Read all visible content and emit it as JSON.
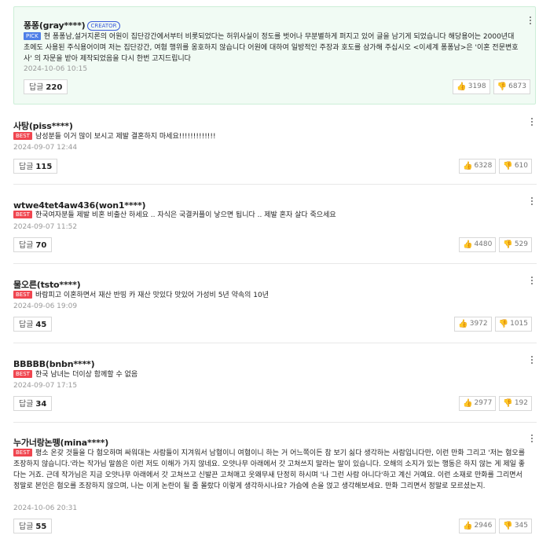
{
  "comments": [
    {
      "author": "퐁퐁(gray****)",
      "badge": "CREATOR",
      "tag": "PICK",
      "text": "현 퐁퐁남,설거지론의 어원이 집단강간에서부터 비롯되었다는 허위사실이 정도를 벗어나 무분별하게 퍼지고 있어 글을 남기게 되었습니다 해당용어는 2000년대 초에도 사용된 주식용어이며 저는 집단강간, 여혐 행위를 옹호하지 않습니다 어원에 대하여 일방적인 주장과 호도를 삼가해 주십시오 <이세계 퐁퐁남>은 '이혼 전문변호사' 의 자문을 받아 제작되었음을 다시 한번 고지드립니다",
      "date": "2024-10-06 10:15",
      "reply_label": "답글",
      "reply_count": "220",
      "likes": "3198",
      "dislikes": "6873"
    },
    {
      "author": "사탕(piss****)",
      "tag": "BEST",
      "text": "남성분들 이거 많이 보시고 제발 결혼하지 마세요!!!!!!!!!!!!!",
      "date": "2024-09-07 12:44",
      "reply_label": "답글",
      "reply_count": "115",
      "likes": "6328",
      "dislikes": "610"
    },
    {
      "author": "wtwe4tet4aw436(won1****)",
      "tag": "BEST",
      "text": "한국여자분들 제발 비혼 비출산 하세요 .. 자식은 국결커플이 낳으면 됩니다 .. 제발 혼자 살다 죽으세요",
      "date": "2024-09-07 11:52",
      "reply_label": "답글",
      "reply_count": "70",
      "likes": "4480",
      "dislikes": "529"
    },
    {
      "author": "물오른(tsto****)",
      "tag": "BEST",
      "text": "바람피고 이혼하면서 재산 반띵 카 재산 맛있다 맛있어 가성비 5년 약속의 10년",
      "date": "2024-09-06 19:09",
      "reply_label": "답글",
      "reply_count": "45",
      "likes": "3972",
      "dislikes": "1015"
    },
    {
      "author": "BBBBB(bnbn****)",
      "tag": "BEST",
      "text": "한국 남녀는 더이상 함께할 수 없음",
      "date": "2024-09-07 17:15",
      "reply_label": "답글",
      "reply_count": "34",
      "likes": "2977",
      "dislikes": "192"
    },
    {
      "author": "누가너랑논뗑(mina****)",
      "tag": "BEST",
      "text": "평소 온갖 것들을 다 혐오하며 싸워대는 사람들이 지겨워서 남혐이니 여혐이니 하는 거 어느쪽이든 참 보기 싫다 생각하는 사람입니다만, 이런 만화 그리고 '저는 혐오를 조장하지 않습니다.'라는 작가님 말씀은 이런 저도 이해가 가지 않네요. 오얏나무 아래에서 갓 고쳐쓰지 말라는 말이 있습니다. 오해의 소지가 있는 행동은 하지 않는 게 제일 좋다는 거죠. 근데 작가님은 지금 오얏나무 아래에서 갓 고쳐쓰고 신발끈 고쳐매고 웃왜무새 단정히 하시며 '나 그런 사람 아니다'하고 계신 거예요. 이런 소재로 만화를 그리면서 정말로 본인은 혐오를 조장하지 않으며, 나는 이게 논란이 될 줄 몰랐다 이렇게 생각하시나요? 가슴에 손을 얹고 생각해보세요. 만화 그리면서 정말로 모르셨는지.",
      "date": "2024-10-06 20:31",
      "reply_label": "답글",
      "reply_count": "55",
      "likes": "2946",
      "dislikes": "345"
    }
  ]
}
